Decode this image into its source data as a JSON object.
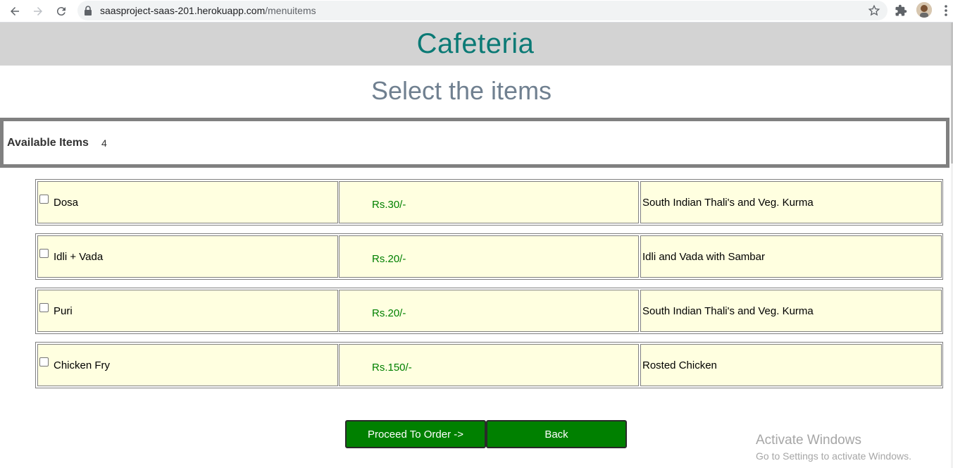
{
  "browser": {
    "url_host": "saasproject-saas-201.herokuapp.com",
    "url_path": "/menuitems",
    "icons": [
      "back-icon",
      "forward-icon",
      "reload-icon",
      "lock-icon",
      "star-icon",
      "extensions-icon",
      "profile-avatar",
      "menu-dots-icon"
    ]
  },
  "header": {
    "brand": "Cafeteria"
  },
  "page": {
    "heading": "Select the items",
    "available_label": "Available Items",
    "available_count": "4"
  },
  "items": [
    {
      "name": "Dosa",
      "price": "Rs.30/-",
      "description": "South Indian Thali's and Veg. Kurma",
      "checked": false
    },
    {
      "name": "Idli + Vada",
      "price": "Rs.20/-",
      "description": "Idli and Vada with Sambar",
      "checked": false
    },
    {
      "name": "Puri",
      "price": "Rs.20/-",
      "description": "South Indian Thali's and Veg. Kurma",
      "checked": false
    },
    {
      "name": "Chicken Fry",
      "price": "Rs.150/-",
      "description": "Rosted Chicken",
      "checked": false
    }
  ],
  "actions": {
    "proceed_label": "Proceed To Order ->",
    "back_label": "Back"
  },
  "watermark": {
    "line1": "Activate Windows",
    "line2": "Go to Settings to activate Windows."
  },
  "colors": {
    "brand": "#0b7a75",
    "heading": "#708090",
    "header_band": "#d3d3d3",
    "cell_bg": "#ffffe0",
    "price_text": "#008000",
    "button_bg": "#008000"
  }
}
